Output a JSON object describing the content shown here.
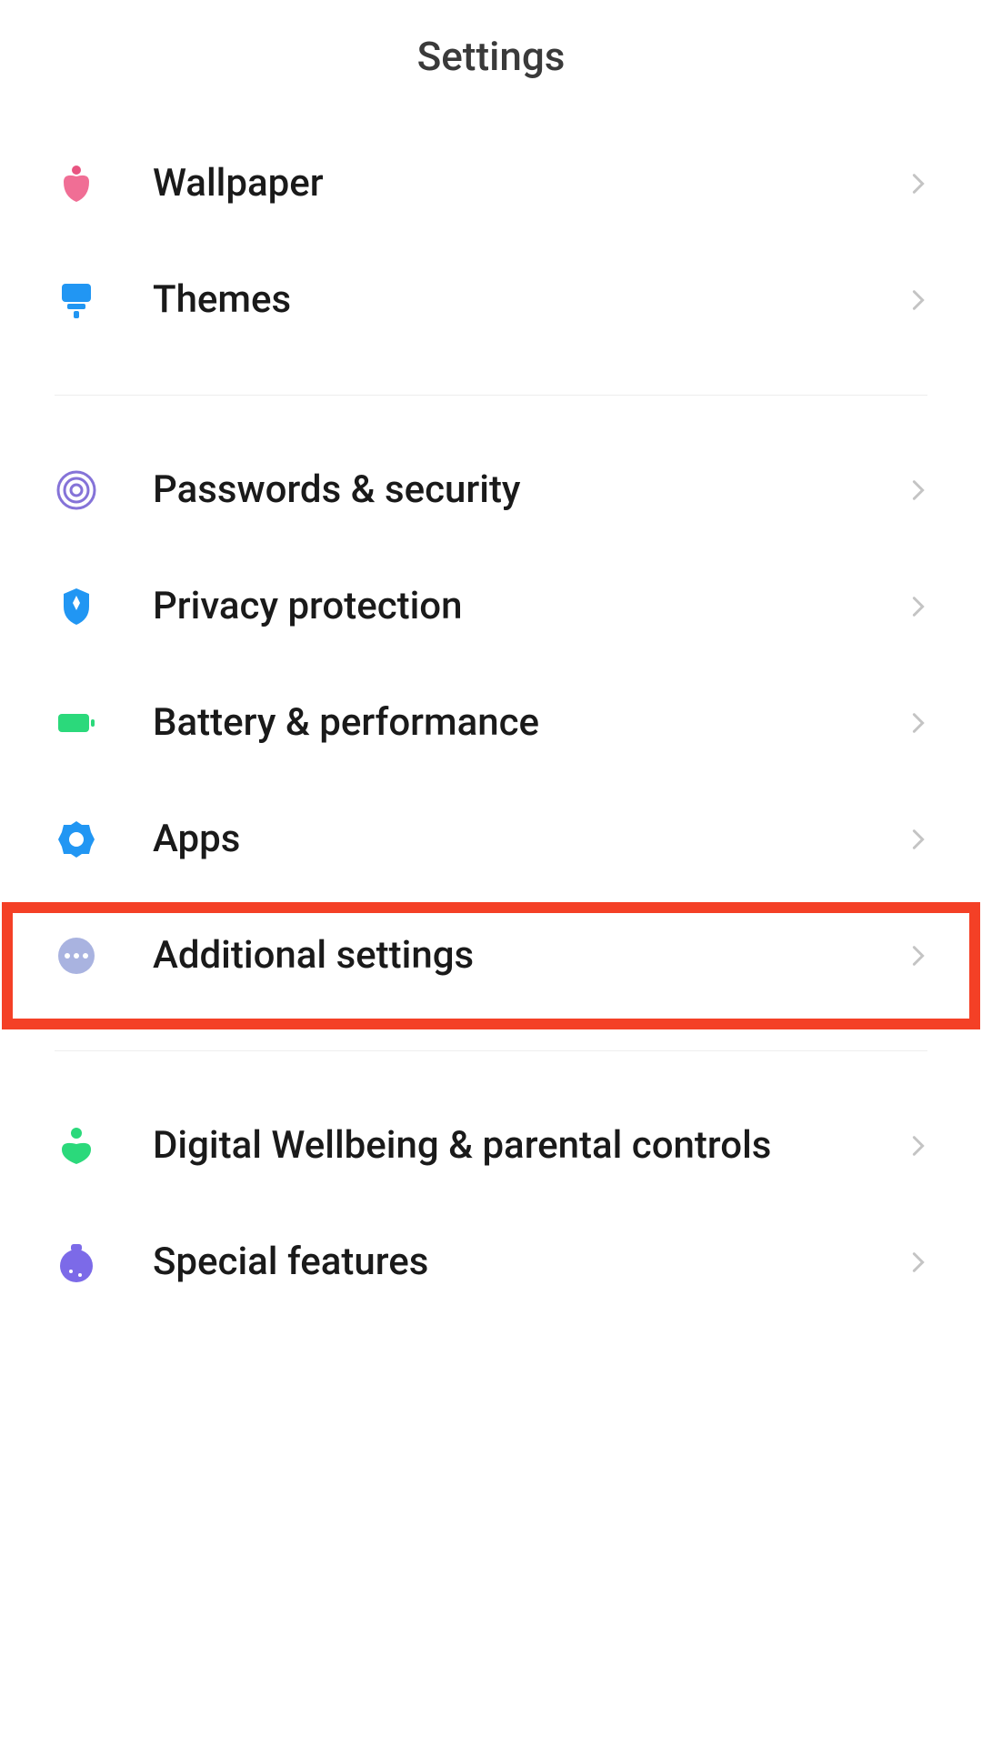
{
  "header": {
    "title": "Settings"
  },
  "items": [
    {
      "label": "Wallpaper",
      "icon": "wallpaper"
    },
    {
      "label": "Themes",
      "icon": "themes"
    },
    {
      "label": "Passwords & security",
      "icon": "security"
    },
    {
      "label": "Privacy protection",
      "icon": "privacy"
    },
    {
      "label": "Battery & performance",
      "icon": "battery"
    },
    {
      "label": "Apps",
      "icon": "apps"
    },
    {
      "label": "Additional settings",
      "icon": "additional"
    },
    {
      "label": "Digital Wellbeing & parental controls",
      "icon": "wellbeing"
    },
    {
      "label": "Special features",
      "icon": "special"
    }
  ],
  "highlight": {
    "item_index": 6
  }
}
